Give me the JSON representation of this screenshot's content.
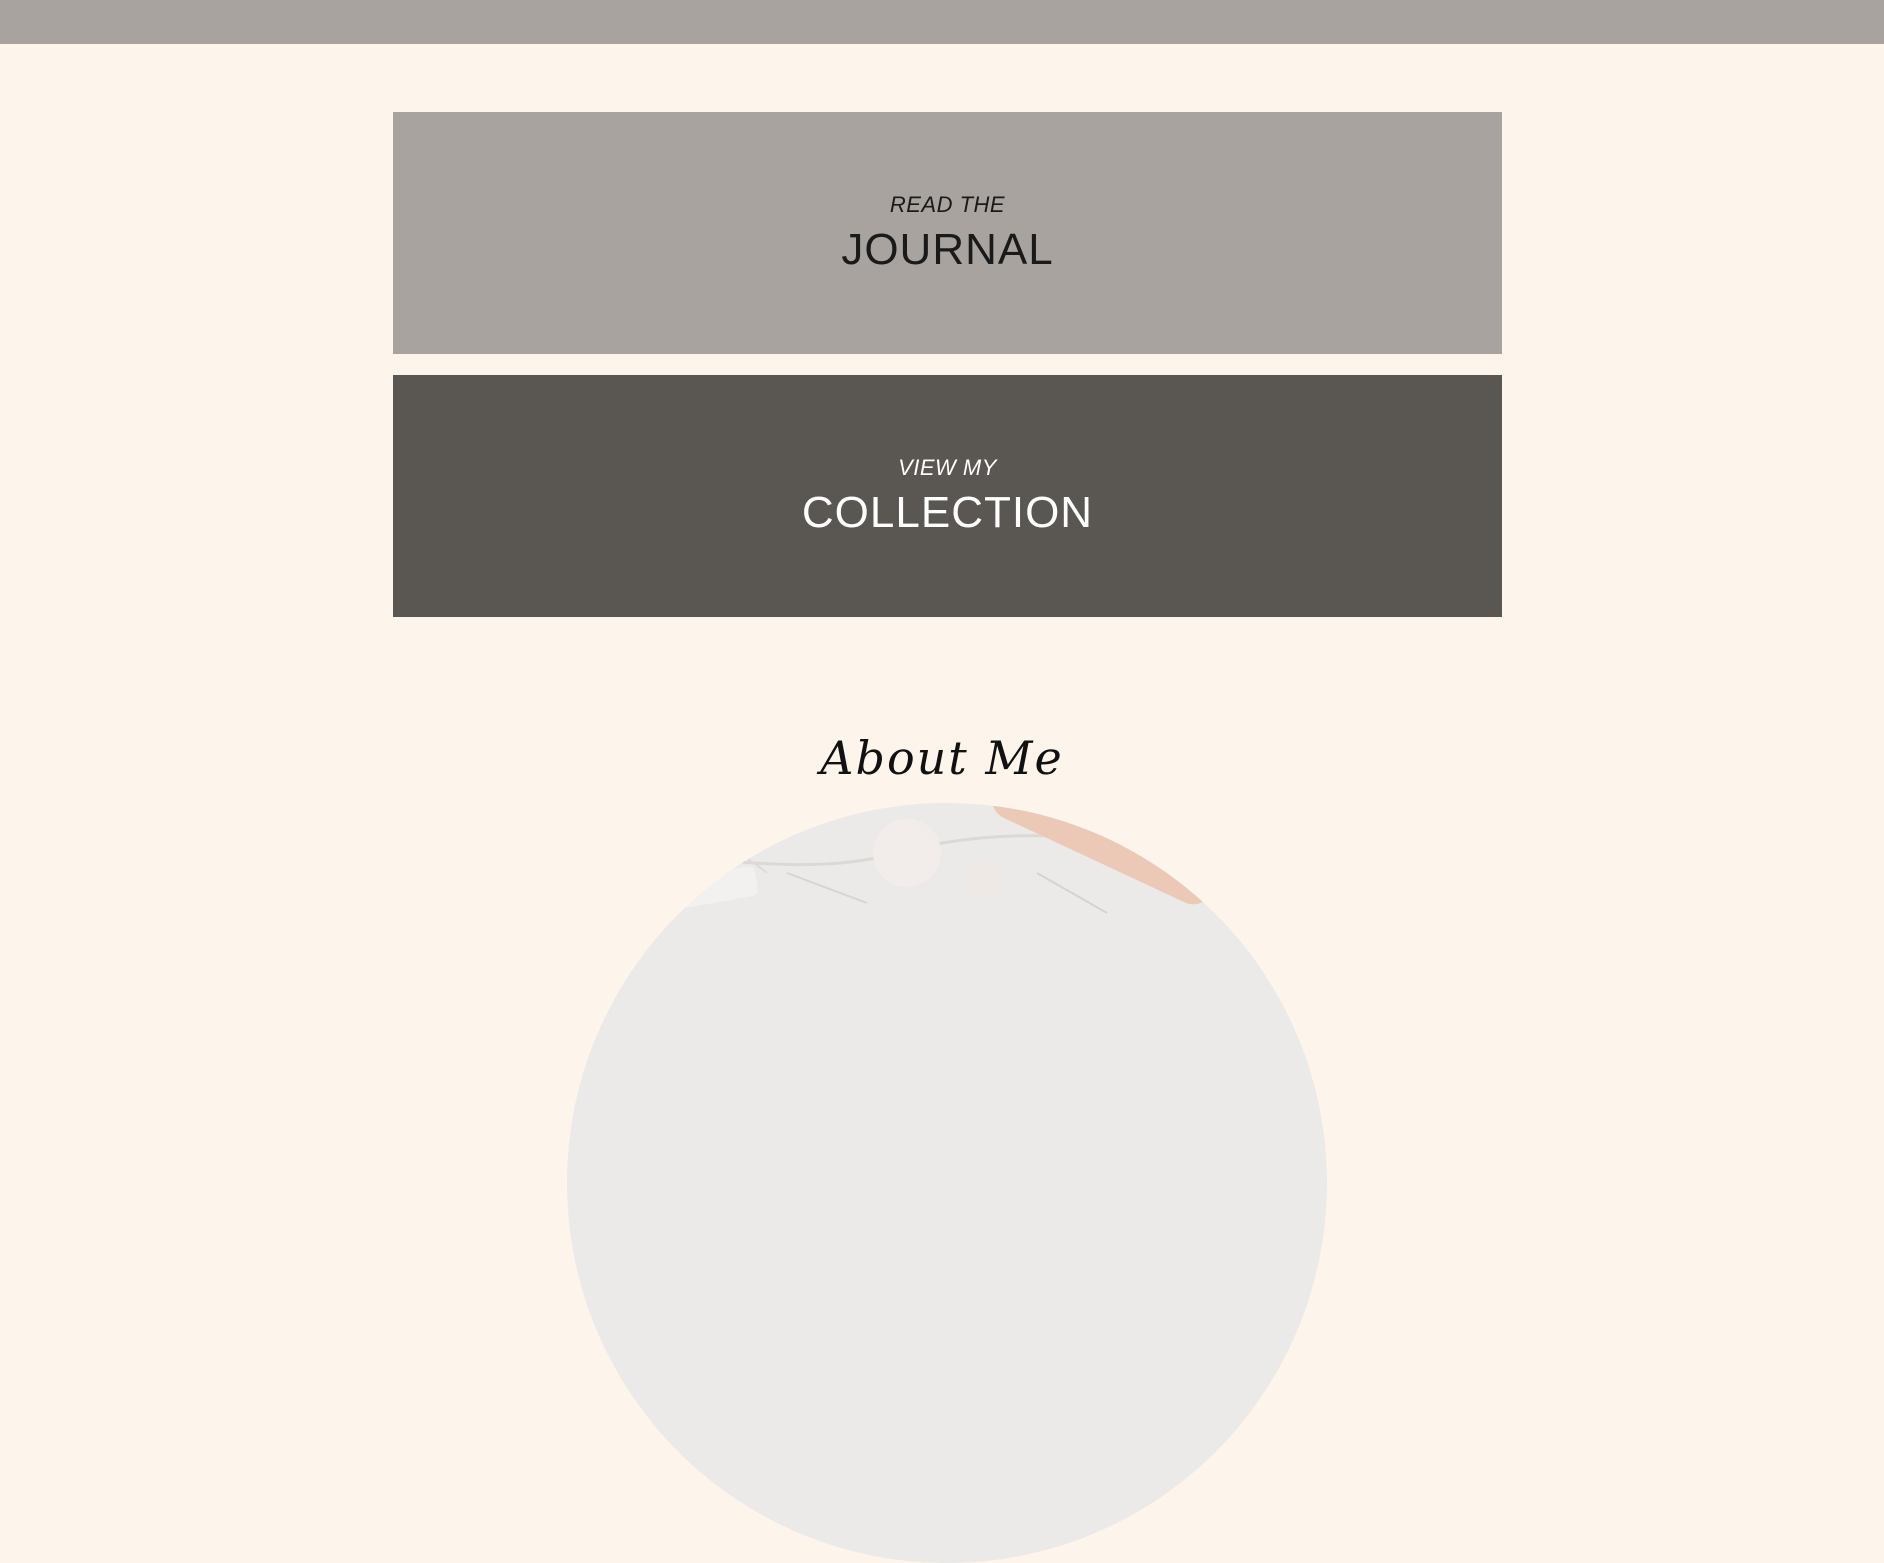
{
  "journal_cta": {
    "eyebrow": "READ THE",
    "headline": "JOURNAL"
  },
  "collection_cta": {
    "eyebrow": "VIEW MY",
    "headline": "COLLECTION"
  },
  "about": {
    "title": "About Me"
  },
  "colors": {
    "background": "#fdf5ec",
    "top_bar": "#a8a39e",
    "journal_panel": "#a8a39e",
    "collection_panel": "#5a5651"
  }
}
